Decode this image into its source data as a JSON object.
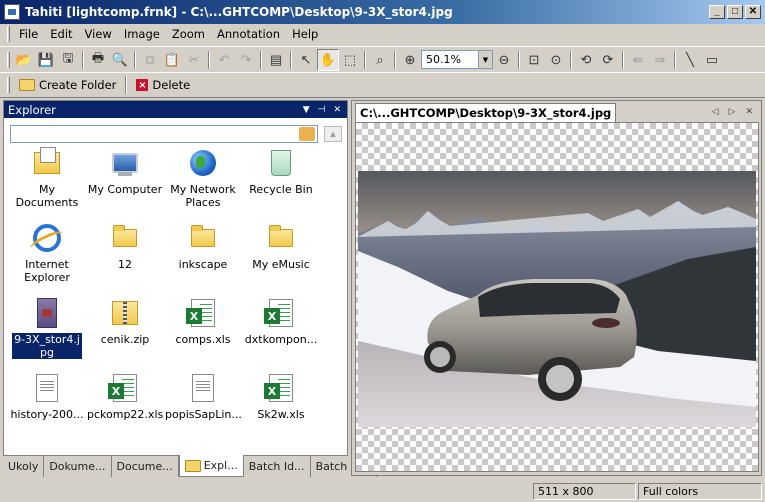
{
  "window": {
    "title": "Tahiti [lightcomp.frnk] - C:\\...GHTCOMP\\Desktop\\9-3X_stor4.jpg",
    "min": "_",
    "max": "□",
    "close": "✕"
  },
  "menu": [
    "File",
    "Edit",
    "View",
    "Image",
    "Zoom",
    "Annotation",
    "Help"
  ],
  "toolbar": {
    "zoom_value": "50.1%"
  },
  "toolbar2": {
    "create_folder": "Create Folder",
    "delete": "Delete"
  },
  "explorer": {
    "title": "Explorer",
    "address_value": "",
    "items": [
      {
        "label": "My Documents",
        "icon": "my-documents-icon"
      },
      {
        "label": "My Computer",
        "icon": "my-computer-icon"
      },
      {
        "label": "My Network Places",
        "icon": "network-places-icon"
      },
      {
        "label": "Recycle Bin",
        "icon": "recycle-bin-icon"
      },
      {
        "label": "Internet Explorer",
        "icon": "internet-explorer-icon"
      },
      {
        "label": "12",
        "icon": "folder-icon"
      },
      {
        "label": "inkscape",
        "icon": "folder-icon"
      },
      {
        "label": "My eMusic",
        "icon": "folder-icon"
      },
      {
        "label": "9-3X_stor4.jpg",
        "icon": "jpg-file-icon",
        "selected": true
      },
      {
        "label": "cenik.zip",
        "icon": "zip-file-icon"
      },
      {
        "label": "comps.xls",
        "icon": "excel-file-icon"
      },
      {
        "label": "dxtkompon...",
        "icon": "excel-file-icon"
      },
      {
        "label": "history-200...",
        "icon": "text-file-icon"
      },
      {
        "label": "pckomp22.xls",
        "icon": "excel-file-icon"
      },
      {
        "label": "popisSapLin...",
        "icon": "text-file-icon"
      },
      {
        "label": "Sk2w.xls",
        "icon": "excel-file-icon"
      }
    ],
    "bottom_tabs": [
      "Ukoly",
      "Dokume...",
      "Docume...",
      "Expl...",
      "Batch Id...",
      "Batch M..."
    ],
    "active_tab": 3
  },
  "viewer": {
    "tab_title": "C:\\...GHTCOMP\\Desktop\\9-3X_stor4.jpg"
  },
  "status": {
    "dimensions": "511 x 800",
    "colors": "Full colors"
  },
  "colors": {
    "titlebar": "#0a246a",
    "selection": "#0a246a",
    "chrome": "#d4d0c8"
  }
}
